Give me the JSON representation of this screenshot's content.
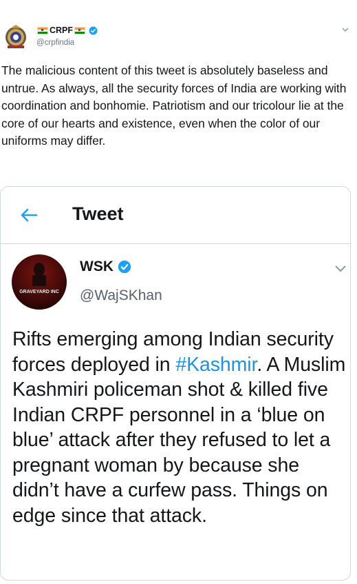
{
  "outer_tweet": {
    "display_name": "CRPF",
    "handle": "@crpfindia",
    "text": "The malicious content of this tweet is absolutely baseless and untrue. As always, all the security forces of India are working with coordination and bonhomie. Patriotism and our tricolour lie at the core of our hearts and existence, even when the color of our uniforms may differ."
  },
  "embedded_screenshot": {
    "header_title": "Tweet",
    "author": {
      "display_name": "WSK",
      "handle": "@WajSKhan",
      "avatar_text": "GRAVEYARD INC"
    },
    "text_before_hashtag": "Rifts emerging among Indian security forces deployed in ",
    "hashtag": "#Kashmir",
    "text_after_hashtag": ". A Muslim Kashmiri policeman shot & killed five Indian CRPF personnel in a ‘blue on blue’ attack after they refused to let a pregnant woman by because she didn’t have a curfew pass. Things on edge since that attack."
  },
  "colors": {
    "verified_blue": "#1da1f2",
    "hashtag_blue": "#1b95e0",
    "text": "#14171a",
    "muted": "#657786"
  },
  "icons": [
    "crpf-emblem-icon",
    "india-flag-icon",
    "verified-badge-icon",
    "chevron-down-icon",
    "back-arrow-icon"
  ]
}
